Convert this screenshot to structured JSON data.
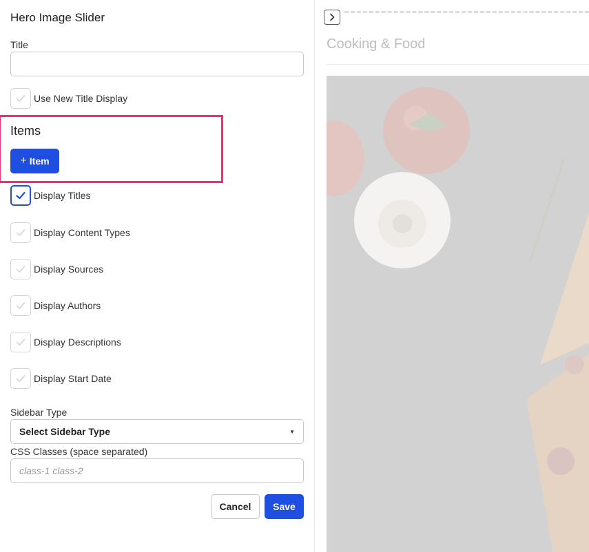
{
  "editor": {
    "title": "Hero Image Slider",
    "title_field": {
      "label": "Title",
      "value": "",
      "placeholder": ""
    },
    "use_new_title_display": {
      "label": "Use New Title Display",
      "checked": false
    },
    "items": {
      "heading": "Items",
      "add_button_icon": "+",
      "add_button_label": "Item"
    },
    "options": [
      {
        "label": "Display Titles",
        "checked": true
      },
      {
        "label": "Display Content Types",
        "checked": false
      },
      {
        "label": "Display Sources",
        "checked": false
      },
      {
        "label": "Display Authors",
        "checked": false
      },
      {
        "label": "Display Descriptions",
        "checked": false
      },
      {
        "label": "Display Start Date",
        "checked": false
      }
    ],
    "sidebar_type": {
      "label": "Sidebar Type",
      "value": "Select Sidebar Type"
    },
    "css_classes": {
      "label": "CSS Classes (space separated)",
      "value": "",
      "placeholder": "class-1 class-2"
    },
    "cancel_label": "Cancel",
    "save_label": "Save"
  },
  "preview": {
    "title": "Cooking & Food"
  },
  "colors": {
    "accent": "#1f4fe0",
    "highlight": "#e0337a"
  }
}
